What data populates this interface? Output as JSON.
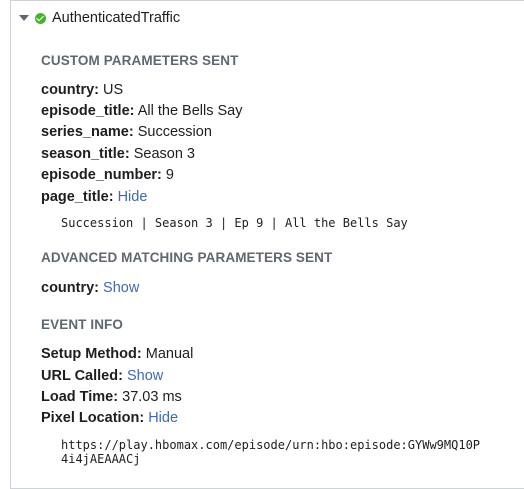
{
  "event": {
    "name": "AuthenticatedTraffic"
  },
  "custom_parameters": {
    "title": "CUSTOM PARAMETERS SENT",
    "rows": [
      {
        "key": "country",
        "value": "US"
      },
      {
        "key": "episode_title",
        "value": "All the Bells Say"
      },
      {
        "key": "series_name",
        "value": "Succession"
      },
      {
        "key": "season_title",
        "value": "Season 3"
      },
      {
        "key": "episode_number",
        "value": "9"
      }
    ],
    "page_title": {
      "key": "page_title",
      "link": "Hide",
      "expanded": "Succession | Season 3 | Ep 9 | All the Bells Say"
    }
  },
  "advanced_matching": {
    "title": "ADVANCED MATCHING PARAMETERS SENT",
    "country": {
      "key": "country",
      "link": "Show"
    }
  },
  "event_info": {
    "title": "EVENT INFO",
    "setup_method": {
      "key": "Setup Method",
      "value": "Manual"
    },
    "url_called": {
      "key": "URL Called",
      "link": "Show"
    },
    "load_time": {
      "key": "Load Time",
      "value": "37.03 ms"
    },
    "pixel_location": {
      "key": "Pixel Location",
      "link": "Hide",
      "line1": "https://play.hbomax.com/episode/urn:hbo:episode:GYWw9MQ10P",
      "line2": "4i4jAEAAACj"
    }
  },
  "colors": {
    "link": "#4267b2",
    "status_ok": "#42b72a",
    "section_title": "#606770"
  }
}
